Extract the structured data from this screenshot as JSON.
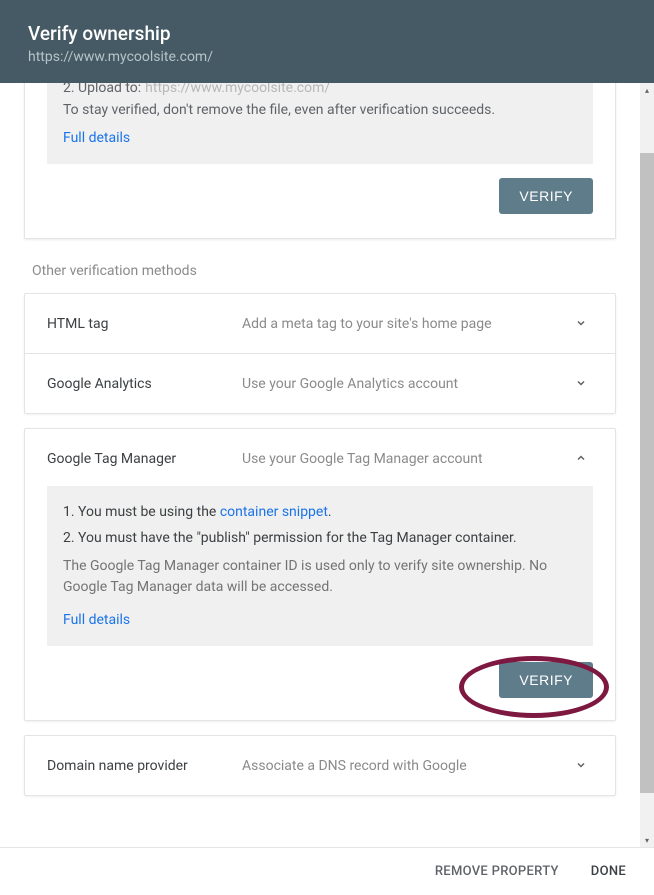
{
  "header": {
    "title": "Verify ownership",
    "url": "https://www.mycoolsite.com/"
  },
  "file_method": {
    "step2_prefix": "2. Upload to: ",
    "step2_url": "https://www.mycoolsite.com/",
    "stay_verified": "To stay verified, don't remove the file, even after verification succeeds.",
    "full_details": "Full details",
    "verify": "VERIFY"
  },
  "other_label": "Other verification methods",
  "methods": {
    "html_tag": {
      "title": "HTML tag",
      "desc": "Add a meta tag to your site's home page"
    },
    "analytics": {
      "title": "Google Analytics",
      "desc": "Use your Google Analytics account"
    },
    "gtm": {
      "title": "Google Tag Manager",
      "desc": "Use your Google Tag Manager account",
      "line1_prefix": "1. You must be using the ",
      "line1_link": "container snippet",
      "line1_suffix": ".",
      "line2": "2. You must have the \"publish\" permission for the Tag Manager container.",
      "note": "The Google Tag Manager container ID is used only to verify site ownership. No Google Tag Manager data will be accessed.",
      "full_details": "Full details",
      "verify": "VERIFY"
    },
    "dns": {
      "title": "Domain name provider",
      "desc": "Associate a DNS record with Google"
    }
  },
  "footer": {
    "remove": "REMOVE PROPERTY",
    "done": "DONE"
  }
}
